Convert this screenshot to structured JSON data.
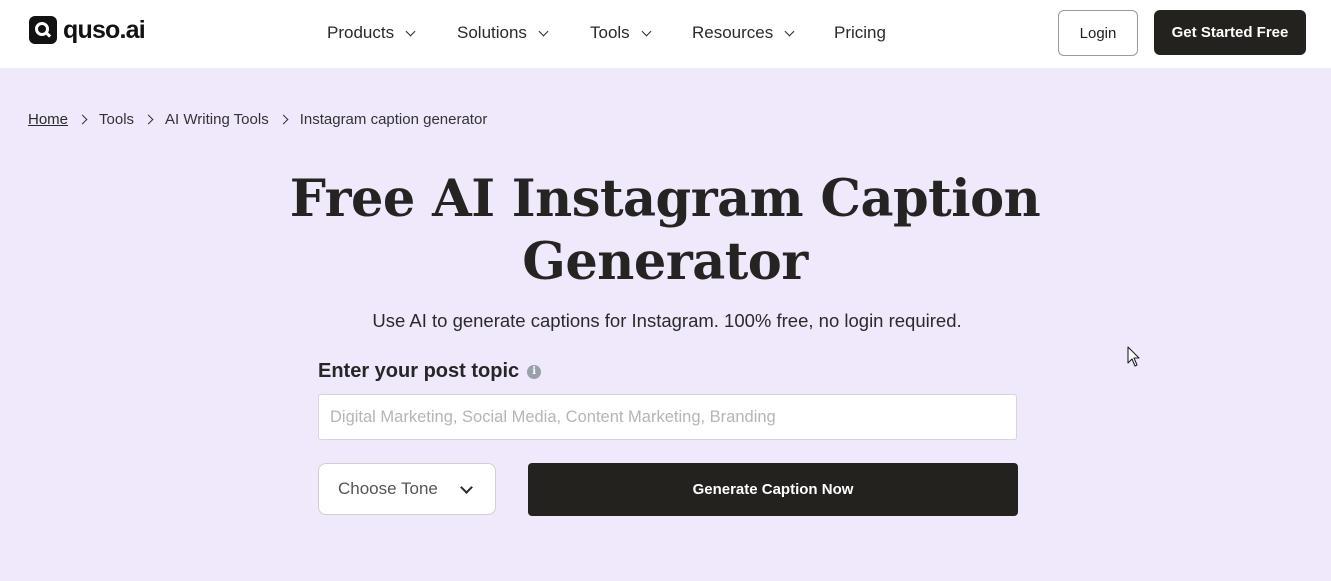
{
  "header": {
    "logo_text": "quso.ai",
    "nav": [
      {
        "label": "Products",
        "has_dropdown": true
      },
      {
        "label": "Solutions",
        "has_dropdown": true
      },
      {
        "label": "Tools",
        "has_dropdown": true
      },
      {
        "label": "Resources",
        "has_dropdown": true
      },
      {
        "label": "Pricing",
        "has_dropdown": false
      }
    ],
    "login_label": "Login",
    "get_started_label": "Get Started Free"
  },
  "breadcrumb": {
    "items": [
      "Home",
      "Tools",
      "AI Writing Tools",
      "Instagram caption generator"
    ]
  },
  "hero": {
    "title_line1": "Free AI Instagram Caption",
    "title_line2": "Generator",
    "subtitle": "Use AI to generate captions for Instagram. 100% free, no login required."
  },
  "form": {
    "topic_label": "Enter your post topic",
    "info_icon": "i",
    "topic_value": "",
    "topic_placeholder": "Digital Marketing, Social Media, Content Marketing, Branding",
    "tone_selected": "Choose Tone",
    "generate_label": "Generate Caption Now"
  },
  "colors": {
    "page_background": "#f0e8fb",
    "header_background": "#ffffff",
    "primary_button": "#23221f",
    "info_icon": "#9aa0aa"
  }
}
